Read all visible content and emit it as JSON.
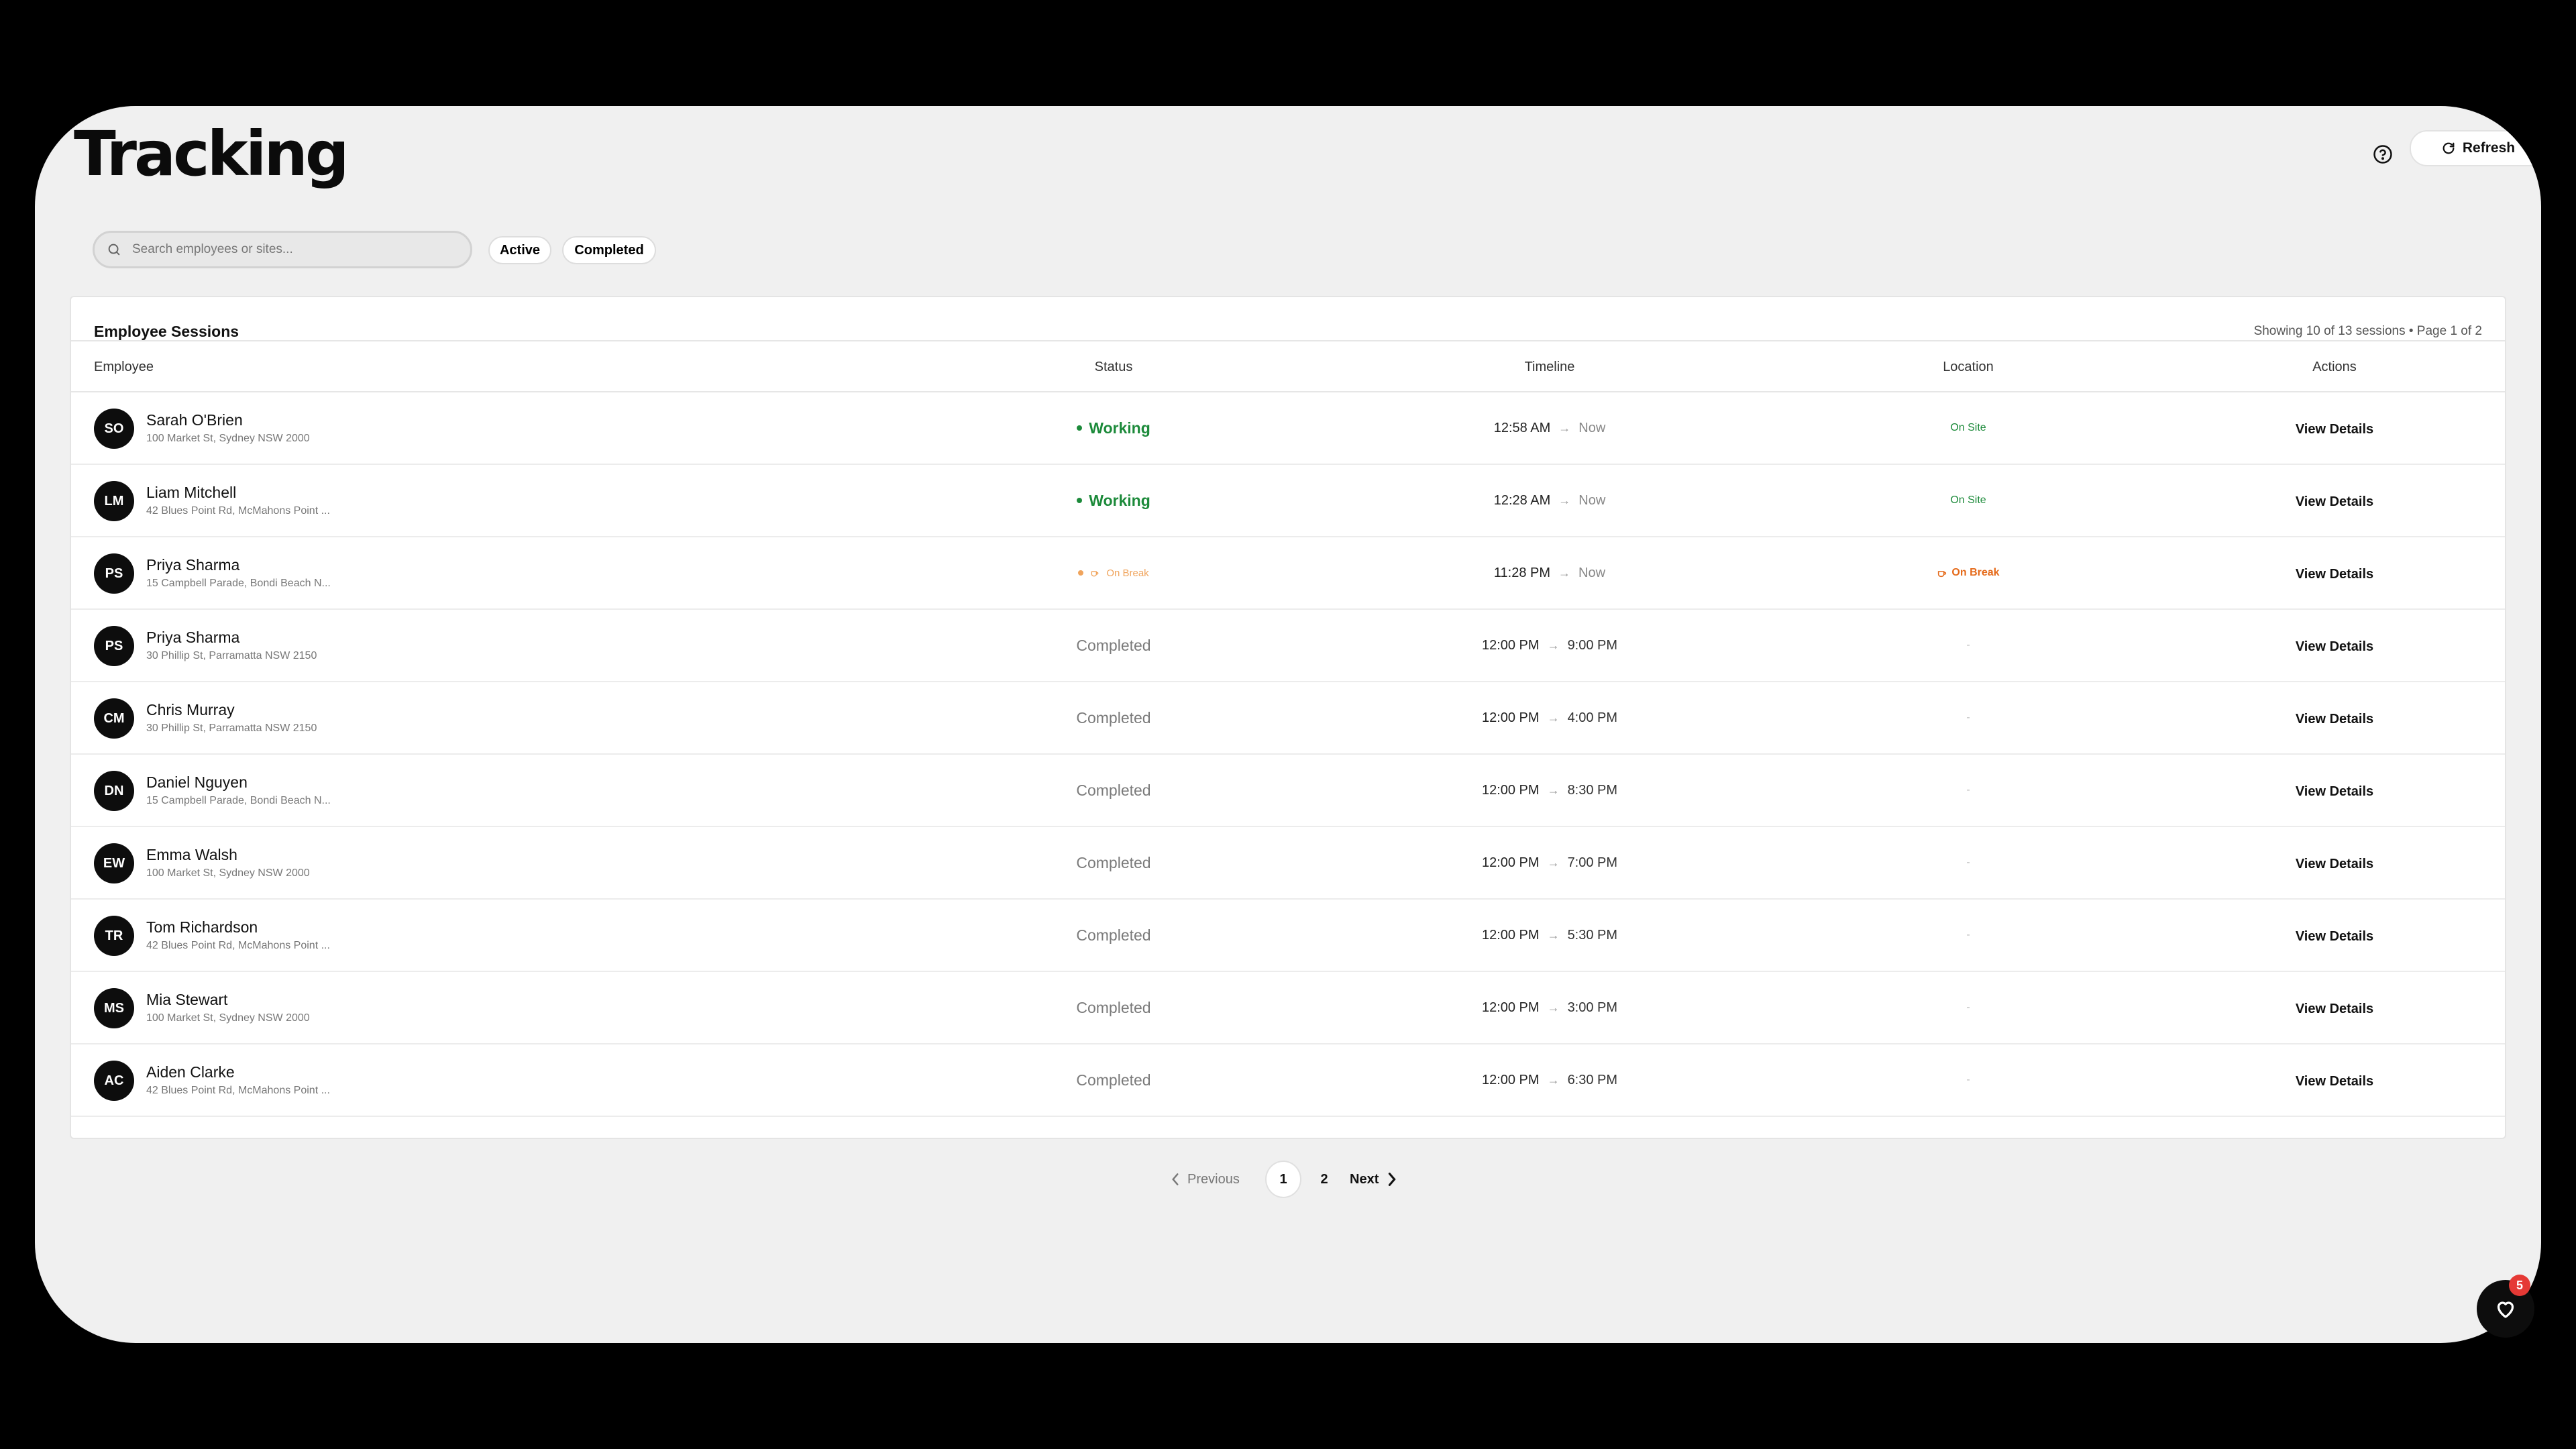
{
  "header": {
    "title": "Tracking",
    "help_icon": "help-circle-icon",
    "refresh_label": "Refresh"
  },
  "search": {
    "placeholder": "Search employees or sites..."
  },
  "filters": {
    "active": "Active",
    "completed": "Completed"
  },
  "table": {
    "title": "Employee Sessions",
    "summary": "Showing 10 of 13 sessions • Page 1 of 2",
    "columns": {
      "employee": "Employee",
      "status": "Status",
      "timeline": "Timeline",
      "location": "Location",
      "actions": "Actions"
    },
    "rows": [
      {
        "initials": "SO",
        "name": "Sarah O'Brien",
        "address": "100 Market St, Sydney NSW 2000",
        "status": "Working",
        "status_type": "working",
        "start": "12:58 AM",
        "end": "Now",
        "location": "On Site",
        "location_type": "onsite",
        "action": "View Details"
      },
      {
        "initials": "LM",
        "name": "Liam Mitchell",
        "address": "42 Blues Point Rd, McMahons Point ...",
        "status": "Working",
        "status_type": "working",
        "start": "12:28 AM",
        "end": "Now",
        "location": "On Site",
        "location_type": "onsite",
        "action": "View Details"
      },
      {
        "initials": "PS",
        "name": "Priya Sharma",
        "address": "15 Campbell Parade, Bondi Beach N...",
        "status": "On Break",
        "status_type": "onbreak",
        "start": "11:28 PM",
        "end": "Now",
        "location": "On Break",
        "location_type": "onbreak",
        "action": "View Details"
      },
      {
        "initials": "PS",
        "name": "Priya Sharma",
        "address": "30 Phillip St, Parramatta NSW 2150",
        "status": "Completed",
        "status_type": "completed",
        "start": "12:00 PM",
        "end": "9:00 PM",
        "location": "-",
        "location_type": "none",
        "action": "View Details"
      },
      {
        "initials": "CM",
        "name": "Chris Murray",
        "address": "30 Phillip St, Parramatta NSW 2150",
        "status": "Completed",
        "status_type": "completed",
        "start": "12:00 PM",
        "end": "4:00 PM",
        "location": "-",
        "location_type": "none",
        "action": "View Details"
      },
      {
        "initials": "DN",
        "name": "Daniel Nguyen",
        "address": "15 Campbell Parade, Bondi Beach N...",
        "status": "Completed",
        "status_type": "completed",
        "start": "12:00 PM",
        "end": "8:30 PM",
        "location": "-",
        "location_type": "none",
        "action": "View Details"
      },
      {
        "initials": "EW",
        "name": "Emma Walsh",
        "address": "100 Market St, Sydney NSW 2000",
        "status": "Completed",
        "status_type": "completed",
        "start": "12:00 PM",
        "end": "7:00 PM",
        "location": "-",
        "location_type": "none",
        "action": "View Details"
      },
      {
        "initials": "TR",
        "name": "Tom Richardson",
        "address": "42 Blues Point Rd, McMahons Point ...",
        "status": "Completed",
        "status_type": "completed",
        "start": "12:00 PM",
        "end": "5:30 PM",
        "location": "-",
        "location_type": "none",
        "action": "View Details"
      },
      {
        "initials": "MS",
        "name": "Mia Stewart",
        "address": "100 Market St, Sydney NSW 2000",
        "status": "Completed",
        "status_type": "completed",
        "start": "12:00 PM",
        "end": "3:00 PM",
        "location": "-",
        "location_type": "none",
        "action": "View Details"
      },
      {
        "initials": "AC",
        "name": "Aiden Clarke",
        "address": "42 Blues Point Rd, McMahons Point ...",
        "status": "Completed",
        "status_type": "completed",
        "start": "12:00 PM",
        "end": "6:30 PM",
        "location": "-",
        "location_type": "none",
        "action": "View Details"
      }
    ]
  },
  "pagination": {
    "previous": "Previous",
    "pages": [
      "1",
      "2"
    ],
    "current": "1",
    "next": "Next"
  },
  "fab": {
    "icon": "heart-icon",
    "badge": "5"
  },
  "colors": {
    "working": "#1c8a3a",
    "on_break": "#e56a1a",
    "badge": "#e53935",
    "app_bg": "#f0f0f0"
  }
}
